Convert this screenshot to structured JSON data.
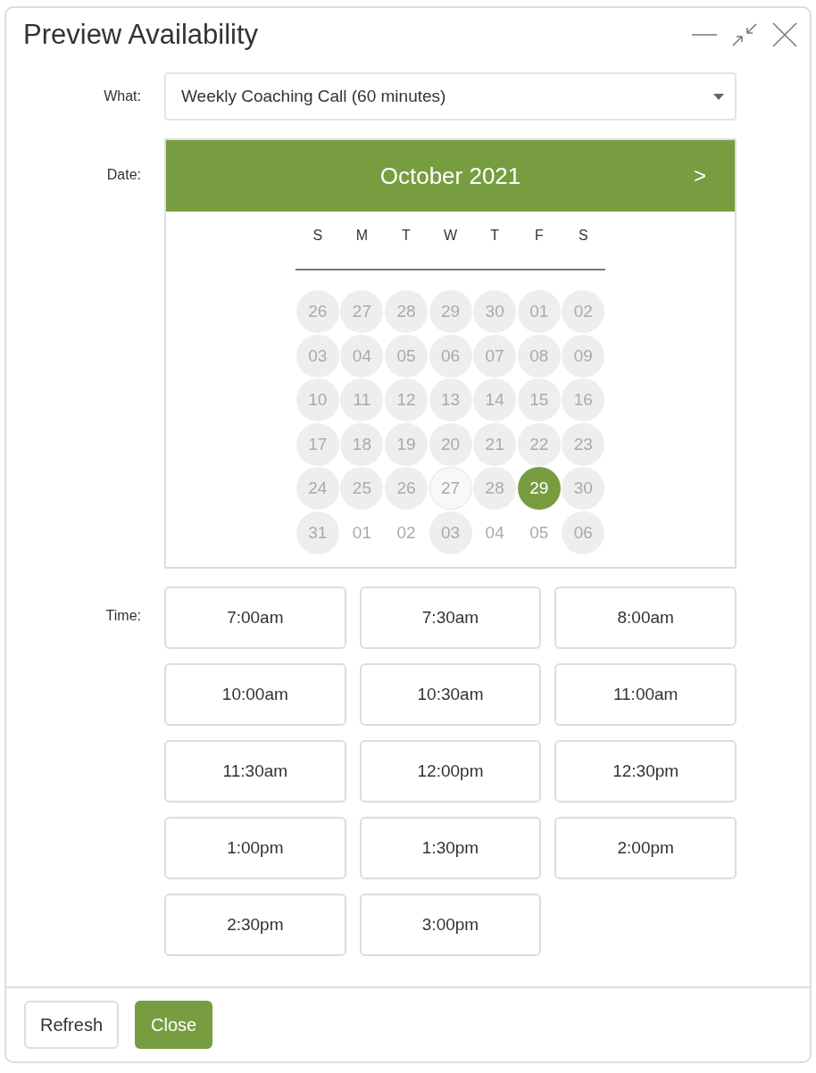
{
  "window": {
    "title": "Preview Availability"
  },
  "what": {
    "label": "What:",
    "value": "Weekly Coaching Call (60 minutes)"
  },
  "date": {
    "label": "Date:",
    "month": "October 2021",
    "next": ">",
    "weekdays": [
      "S",
      "M",
      "T",
      "W",
      "T",
      "F",
      "S"
    ],
    "days": [
      {
        "text": "26",
        "shaded": true,
        "today": false,
        "selected": false
      },
      {
        "text": "27",
        "shaded": true,
        "today": false,
        "selected": false
      },
      {
        "text": "28",
        "shaded": true,
        "today": false,
        "selected": false
      },
      {
        "text": "29",
        "shaded": true,
        "today": false,
        "selected": false
      },
      {
        "text": "30",
        "shaded": true,
        "today": false,
        "selected": false
      },
      {
        "text": "01",
        "shaded": true,
        "today": false,
        "selected": false
      },
      {
        "text": "02",
        "shaded": true,
        "today": false,
        "selected": false
      },
      {
        "text": "03",
        "shaded": true,
        "today": false,
        "selected": false
      },
      {
        "text": "04",
        "shaded": true,
        "today": false,
        "selected": false
      },
      {
        "text": "05",
        "shaded": true,
        "today": false,
        "selected": false
      },
      {
        "text": "06",
        "shaded": true,
        "today": false,
        "selected": false
      },
      {
        "text": "07",
        "shaded": true,
        "today": false,
        "selected": false
      },
      {
        "text": "08",
        "shaded": true,
        "today": false,
        "selected": false
      },
      {
        "text": "09",
        "shaded": true,
        "today": false,
        "selected": false
      },
      {
        "text": "10",
        "shaded": true,
        "today": false,
        "selected": false
      },
      {
        "text": "11",
        "shaded": true,
        "today": false,
        "selected": false
      },
      {
        "text": "12",
        "shaded": true,
        "today": false,
        "selected": false
      },
      {
        "text": "13",
        "shaded": true,
        "today": false,
        "selected": false
      },
      {
        "text": "14",
        "shaded": true,
        "today": false,
        "selected": false
      },
      {
        "text": "15",
        "shaded": true,
        "today": false,
        "selected": false
      },
      {
        "text": "16",
        "shaded": true,
        "today": false,
        "selected": false
      },
      {
        "text": "17",
        "shaded": true,
        "today": false,
        "selected": false
      },
      {
        "text": "18",
        "shaded": true,
        "today": false,
        "selected": false
      },
      {
        "text": "19",
        "shaded": true,
        "today": false,
        "selected": false
      },
      {
        "text": "20",
        "shaded": true,
        "today": false,
        "selected": false
      },
      {
        "text": "21",
        "shaded": true,
        "today": false,
        "selected": false
      },
      {
        "text": "22",
        "shaded": true,
        "today": false,
        "selected": false
      },
      {
        "text": "23",
        "shaded": true,
        "today": false,
        "selected": false
      },
      {
        "text": "24",
        "shaded": true,
        "today": false,
        "selected": false
      },
      {
        "text": "25",
        "shaded": true,
        "today": false,
        "selected": false
      },
      {
        "text": "26",
        "shaded": true,
        "today": false,
        "selected": false
      },
      {
        "text": "27",
        "shaded": true,
        "today": true,
        "selected": false
      },
      {
        "text": "28",
        "shaded": true,
        "today": false,
        "selected": false
      },
      {
        "text": "29",
        "shaded": false,
        "today": false,
        "selected": true
      },
      {
        "text": "30",
        "shaded": true,
        "today": false,
        "selected": false
      },
      {
        "text": "31",
        "shaded": true,
        "today": false,
        "selected": false
      },
      {
        "text": "01",
        "shaded": false,
        "today": false,
        "selected": false
      },
      {
        "text": "02",
        "shaded": false,
        "today": false,
        "selected": false
      },
      {
        "text": "03",
        "shaded": true,
        "today": false,
        "selected": false
      },
      {
        "text": "04",
        "shaded": false,
        "today": false,
        "selected": false
      },
      {
        "text": "05",
        "shaded": false,
        "today": false,
        "selected": false
      },
      {
        "text": "06",
        "shaded": true,
        "today": false,
        "selected": false
      }
    ]
  },
  "time": {
    "label": "Time:",
    "slots": [
      "7:00am",
      "7:30am",
      "8:00am",
      "10:00am",
      "10:30am",
      "11:00am",
      "11:30am",
      "12:00pm",
      "12:30pm",
      "1:00pm",
      "1:30pm",
      "2:00pm",
      "2:30pm",
      "3:00pm"
    ]
  },
  "buttons": [
    {
      "label": "Refresh",
      "kind": "secondary"
    },
    {
      "label": "Close",
      "kind": "primary"
    }
  ]
}
